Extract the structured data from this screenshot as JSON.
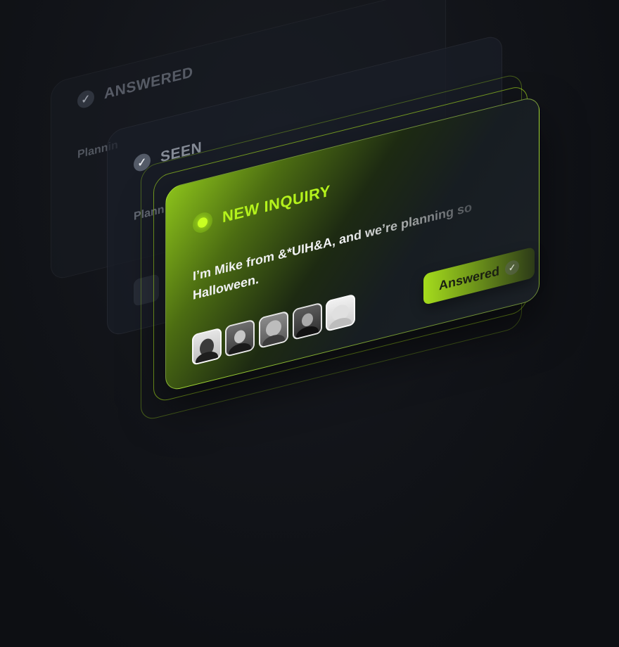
{
  "cards": {
    "answered": {
      "status": "ANSWERED",
      "preview": "Plannin"
    },
    "seen": {
      "status": "SEEN",
      "preview": "Plann"
    },
    "new_inquiry": {
      "status": "NEW INQUIRY",
      "message_line1": "I’m Mike from &*UIH&A, and we’re planning so",
      "message_line2": "Halloween.",
      "action_label": "Answered",
      "avatars": [
        "avatar-1",
        "avatar-2",
        "avatar-3",
        "avatar-4",
        "avatar-5"
      ]
    }
  },
  "colors": {
    "accent": "#b4f21c",
    "background": "#0d0f13"
  },
  "icons": {
    "check": "check-icon",
    "live": "live-dot-icon"
  }
}
